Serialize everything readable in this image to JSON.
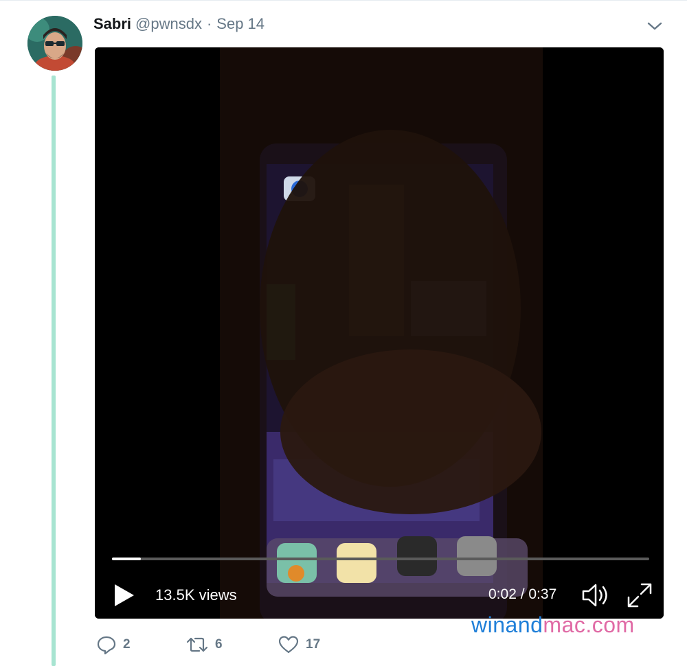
{
  "tweet": {
    "author_name": "Sabri",
    "handle": "@pwnsdx",
    "separator": "·",
    "date": "Sep 14",
    "caret_icon": "chevron-down-icon"
  },
  "video": {
    "views": "13.5K views",
    "time": "0:02 / 0:37",
    "progress": 0.054,
    "icons": [
      "play-icon",
      "volume-icon",
      "fullscreen-icon"
    ]
  },
  "actions": {
    "reply_count": "2",
    "retweet_count": "6",
    "like_count": "17",
    "icons": [
      "reply-icon",
      "retweet-icon",
      "heart-icon"
    ]
  },
  "watermark": {
    "part1": "winand",
    "part2": "mac.com"
  },
  "colors": {
    "thread_line": "#a7e4d1",
    "secondary_text": "#657786",
    "video_bg": "#000000",
    "watermark_blue": "#1f7fd8",
    "watermark_pink": "#e06aa5"
  }
}
